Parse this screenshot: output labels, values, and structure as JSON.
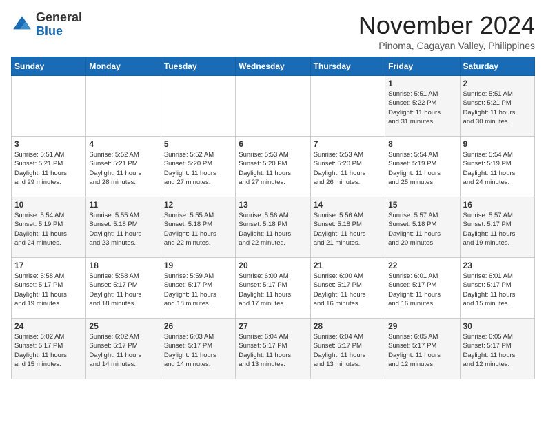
{
  "header": {
    "logo_line1": "General",
    "logo_line2": "Blue",
    "month_title": "November 2024",
    "location": "Pinoma, Cagayan Valley, Philippines"
  },
  "days_of_week": [
    "Sunday",
    "Monday",
    "Tuesday",
    "Wednesday",
    "Thursday",
    "Friday",
    "Saturday"
  ],
  "weeks": [
    [
      {
        "day": "",
        "info": ""
      },
      {
        "day": "",
        "info": ""
      },
      {
        "day": "",
        "info": ""
      },
      {
        "day": "",
        "info": ""
      },
      {
        "day": "",
        "info": ""
      },
      {
        "day": "1",
        "info": "Sunrise: 5:51 AM\nSunset: 5:22 PM\nDaylight: 11 hours\nand 31 minutes."
      },
      {
        "day": "2",
        "info": "Sunrise: 5:51 AM\nSunset: 5:21 PM\nDaylight: 11 hours\nand 30 minutes."
      }
    ],
    [
      {
        "day": "3",
        "info": "Sunrise: 5:51 AM\nSunset: 5:21 PM\nDaylight: 11 hours\nand 29 minutes."
      },
      {
        "day": "4",
        "info": "Sunrise: 5:52 AM\nSunset: 5:21 PM\nDaylight: 11 hours\nand 28 minutes."
      },
      {
        "day": "5",
        "info": "Sunrise: 5:52 AM\nSunset: 5:20 PM\nDaylight: 11 hours\nand 27 minutes."
      },
      {
        "day": "6",
        "info": "Sunrise: 5:53 AM\nSunset: 5:20 PM\nDaylight: 11 hours\nand 27 minutes."
      },
      {
        "day": "7",
        "info": "Sunrise: 5:53 AM\nSunset: 5:20 PM\nDaylight: 11 hours\nand 26 minutes."
      },
      {
        "day": "8",
        "info": "Sunrise: 5:54 AM\nSunset: 5:19 PM\nDaylight: 11 hours\nand 25 minutes."
      },
      {
        "day": "9",
        "info": "Sunrise: 5:54 AM\nSunset: 5:19 PM\nDaylight: 11 hours\nand 24 minutes."
      }
    ],
    [
      {
        "day": "10",
        "info": "Sunrise: 5:54 AM\nSunset: 5:19 PM\nDaylight: 11 hours\nand 24 minutes."
      },
      {
        "day": "11",
        "info": "Sunrise: 5:55 AM\nSunset: 5:18 PM\nDaylight: 11 hours\nand 23 minutes."
      },
      {
        "day": "12",
        "info": "Sunrise: 5:55 AM\nSunset: 5:18 PM\nDaylight: 11 hours\nand 22 minutes."
      },
      {
        "day": "13",
        "info": "Sunrise: 5:56 AM\nSunset: 5:18 PM\nDaylight: 11 hours\nand 22 minutes."
      },
      {
        "day": "14",
        "info": "Sunrise: 5:56 AM\nSunset: 5:18 PM\nDaylight: 11 hours\nand 21 minutes."
      },
      {
        "day": "15",
        "info": "Sunrise: 5:57 AM\nSunset: 5:18 PM\nDaylight: 11 hours\nand 20 minutes."
      },
      {
        "day": "16",
        "info": "Sunrise: 5:57 AM\nSunset: 5:17 PM\nDaylight: 11 hours\nand 19 minutes."
      }
    ],
    [
      {
        "day": "17",
        "info": "Sunrise: 5:58 AM\nSunset: 5:17 PM\nDaylight: 11 hours\nand 19 minutes."
      },
      {
        "day": "18",
        "info": "Sunrise: 5:58 AM\nSunset: 5:17 PM\nDaylight: 11 hours\nand 18 minutes."
      },
      {
        "day": "19",
        "info": "Sunrise: 5:59 AM\nSunset: 5:17 PM\nDaylight: 11 hours\nand 18 minutes."
      },
      {
        "day": "20",
        "info": "Sunrise: 6:00 AM\nSunset: 5:17 PM\nDaylight: 11 hours\nand 17 minutes."
      },
      {
        "day": "21",
        "info": "Sunrise: 6:00 AM\nSunset: 5:17 PM\nDaylight: 11 hours\nand 16 minutes."
      },
      {
        "day": "22",
        "info": "Sunrise: 6:01 AM\nSunset: 5:17 PM\nDaylight: 11 hours\nand 16 minutes."
      },
      {
        "day": "23",
        "info": "Sunrise: 6:01 AM\nSunset: 5:17 PM\nDaylight: 11 hours\nand 15 minutes."
      }
    ],
    [
      {
        "day": "24",
        "info": "Sunrise: 6:02 AM\nSunset: 5:17 PM\nDaylight: 11 hours\nand 15 minutes."
      },
      {
        "day": "25",
        "info": "Sunrise: 6:02 AM\nSunset: 5:17 PM\nDaylight: 11 hours\nand 14 minutes."
      },
      {
        "day": "26",
        "info": "Sunrise: 6:03 AM\nSunset: 5:17 PM\nDaylight: 11 hours\nand 14 minutes."
      },
      {
        "day": "27",
        "info": "Sunrise: 6:04 AM\nSunset: 5:17 PM\nDaylight: 11 hours\nand 13 minutes."
      },
      {
        "day": "28",
        "info": "Sunrise: 6:04 AM\nSunset: 5:17 PM\nDaylight: 11 hours\nand 13 minutes."
      },
      {
        "day": "29",
        "info": "Sunrise: 6:05 AM\nSunset: 5:17 PM\nDaylight: 11 hours\nand 12 minutes."
      },
      {
        "day": "30",
        "info": "Sunrise: 6:05 AM\nSunset: 5:17 PM\nDaylight: 11 hours\nand 12 minutes."
      }
    ]
  ]
}
